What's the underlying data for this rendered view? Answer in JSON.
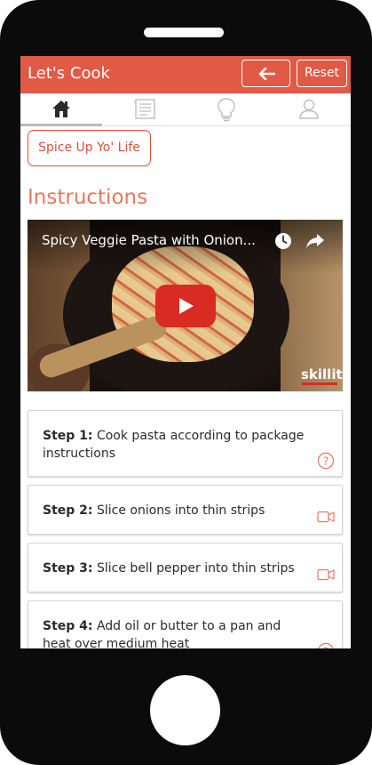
{
  "header": {
    "title": "Let's Cook",
    "back_icon": "arrow-left-icon",
    "reset_label": "Reset",
    "color": "#e05a45"
  },
  "tabs": [
    {
      "icon": "home-icon",
      "active": true
    },
    {
      "icon": "list-icon",
      "active": false
    },
    {
      "icon": "lightbulb-icon",
      "active": false
    },
    {
      "icon": "user-icon",
      "active": false
    }
  ],
  "spice_button": {
    "label": "Spice Up Yo' Life"
  },
  "section_title": "Instructions",
  "video": {
    "title": "Spicy Veggie Pasta with Onion...",
    "brand": "skillit",
    "icons": [
      "clock-icon",
      "share-icon",
      "play-icon"
    ]
  },
  "steps": [
    {
      "label": "Step 1:",
      "text": "Cook pasta according to package instructions",
      "icon": "help-icon"
    },
    {
      "label": "Step 2:",
      "text": "Slice onions into thin strips",
      "icon": "video-camera-icon"
    },
    {
      "label": "Step 3:",
      "text": "Slice bell pepper into thin strips",
      "icon": "video-camera-icon"
    },
    {
      "label": "Step 4:",
      "text": "Add oil or butter to a pan and heat over medium heat",
      "icon": "help-icon"
    }
  ],
  "accent_color": "#d9503c"
}
